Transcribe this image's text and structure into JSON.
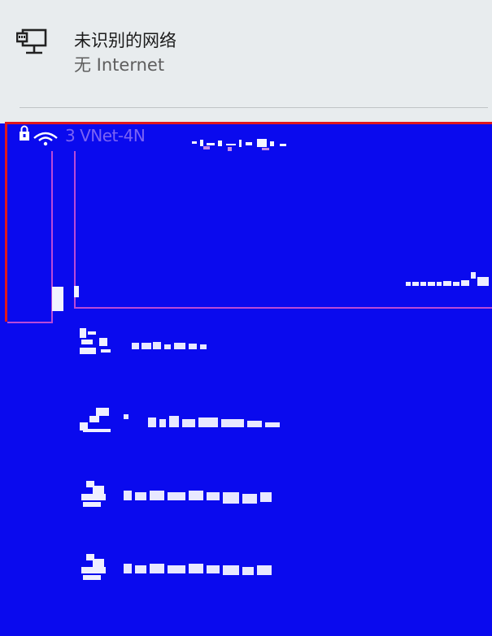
{
  "current_network": {
    "name": "未识别的网络",
    "status": "无 Internet",
    "icon": "ethernet-icon"
  },
  "selected_network": {
    "ssid": "3 VNet-4N",
    "secured": true,
    "icons": [
      "lock-icon",
      "wifi-icon"
    ]
  },
  "colors": {
    "panel_bg": "#e8ecee",
    "corrupted_bg": "#0a0aee",
    "highlight_border": "#e0181d",
    "selection_accent": "#b94ad8"
  }
}
